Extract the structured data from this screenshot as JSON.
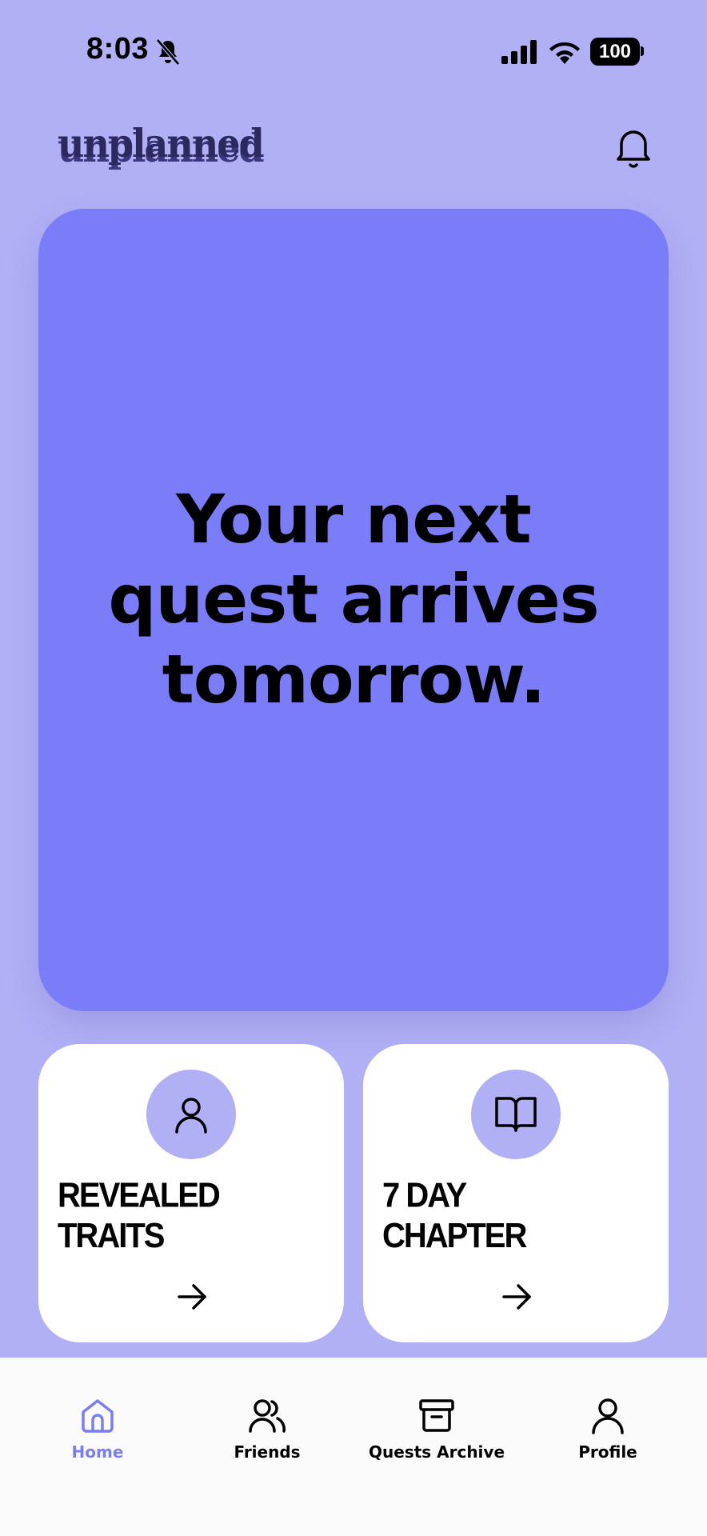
{
  "status_bar": {
    "time": "8:03",
    "battery": "100",
    "icons": [
      "bell-muted-icon",
      "signal-icon",
      "wifi-icon",
      "battery-icon"
    ]
  },
  "header": {
    "logo": "unplanned",
    "notification_icon": "bell-icon"
  },
  "hero": {
    "message": "Your next quest arrives tomorrow."
  },
  "cards": [
    {
      "title": "REVEALED\nTRAITS",
      "icon": "person-icon"
    },
    {
      "title": "7 DAY\nCHAPTER",
      "icon": "book-icon"
    }
  ],
  "nav": {
    "items": [
      {
        "label": "Home",
        "icon": "home-icon",
        "active": true
      },
      {
        "label": "Friends",
        "icon": "friends-icon",
        "active": false
      },
      {
        "label": "Quests Archive",
        "icon": "archive-icon",
        "active": false
      },
      {
        "label": "Profile",
        "icon": "profile-icon",
        "active": false
      }
    ]
  },
  "colors": {
    "background": "#b1b0f5",
    "hero": "#7b7cf7",
    "accent": "#7b7cf7",
    "logo": "#2c295e"
  }
}
